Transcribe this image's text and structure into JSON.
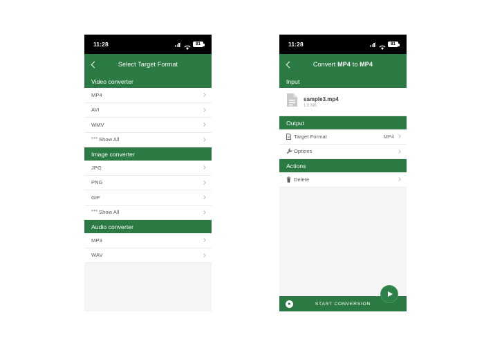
{
  "status_bar": {
    "time": "11:28",
    "signal_icon": "signal-bars-icon",
    "wifi_icon": "wifi-icon",
    "battery_icon": "battery-icon",
    "battery_level": "81"
  },
  "left_phone": {
    "appbar": {
      "back_icon": "chevron-left-icon",
      "title": "Select Target Format"
    },
    "sections": [
      {
        "header": "Video converter",
        "rows": [
          {
            "label": "MP4",
            "icon": "",
            "value": ""
          },
          {
            "label": "AVI",
            "icon": "",
            "value": ""
          },
          {
            "label": "WMV",
            "icon": "",
            "value": ""
          },
          {
            "label": "Show All",
            "icon": "ellipsis-icon",
            "value": ""
          }
        ]
      },
      {
        "header": "Image converter",
        "rows": [
          {
            "label": "JPG",
            "icon": "",
            "value": ""
          },
          {
            "label": "PNG",
            "icon": "",
            "value": ""
          },
          {
            "label": "GIF",
            "icon": "",
            "value": ""
          },
          {
            "label": "Show All",
            "icon": "ellipsis-icon",
            "value": ""
          }
        ]
      },
      {
        "header": "Audio converter",
        "rows": [
          {
            "label": "MP3",
            "icon": "",
            "value": ""
          },
          {
            "label": "WAV",
            "icon": "",
            "value": ""
          }
        ]
      }
    ]
  },
  "right_phone": {
    "appbar": {
      "back_icon": "chevron-left-icon",
      "title_prefix": "Convert ",
      "title_source_format": "MP4",
      "title_middle": " to ",
      "title_target_format": "MP4"
    },
    "input_section": {
      "header": "Input",
      "file": {
        "icon": "file-document-icon",
        "name": "sample3.mp4",
        "size": "1.6 MB"
      }
    },
    "output_section": {
      "header": "Output",
      "rows": [
        {
          "label": "Target Format",
          "icon": "file-document-icon",
          "value": "MP4"
        },
        {
          "label": "Options",
          "icon": "wrench-icon",
          "value": ""
        }
      ]
    },
    "actions_section": {
      "header": "Actions",
      "rows": [
        {
          "label": "Delete",
          "icon": "trash-icon",
          "value": ""
        }
      ]
    },
    "cta": {
      "label": "START CONVERSION",
      "play_icon": "play-circle-icon"
    },
    "fab": {
      "icon": "play-icon"
    }
  },
  "colors": {
    "brand_green": "#2b7a43",
    "screen_background": "#f5f5f5",
    "row_background": "#ffffff",
    "status_bar_background": "#000000"
  }
}
